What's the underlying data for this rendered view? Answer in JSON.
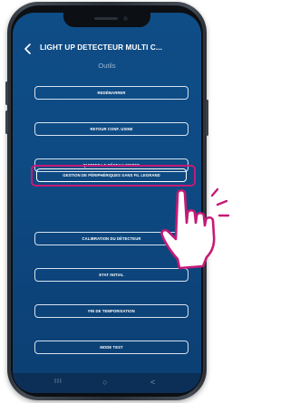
{
  "header": {
    "title": "LIGHT UP DETECTEUR MULTI C...",
    "back_icon": "chevron-left-icon"
  },
  "section": {
    "title": "Outils"
  },
  "menu": {
    "items": [
      {
        "label": "REDÉMARRER"
      },
      {
        "label": "RETOUR CONF. USINE"
      },
      {
        "label": "QUITTER LE RÉSEAU ZIGBEE"
      },
      {
        "label": "GESTION DE PÉRIPHÉRIQUES SANS FIL LEGRAND"
      },
      {
        "label": "CALIBRATION DU DÉTECTEUR"
      },
      {
        "label": "ETAT INITIAL"
      },
      {
        "label": "FIN DE TEMPORISATION"
      },
      {
        "label": "MODE TEST"
      }
    ],
    "highlighted_index": 3
  },
  "nav": {
    "recent_glyph": "III",
    "home_glyph": "○",
    "back_glyph": "<"
  },
  "colors": {
    "screen_bg": "#0f4d87",
    "highlight_frame": "#c51a77",
    "hand_outline": "#c51a77"
  },
  "overlay": {
    "pointer_icon": "hand-pointer-icon"
  }
}
